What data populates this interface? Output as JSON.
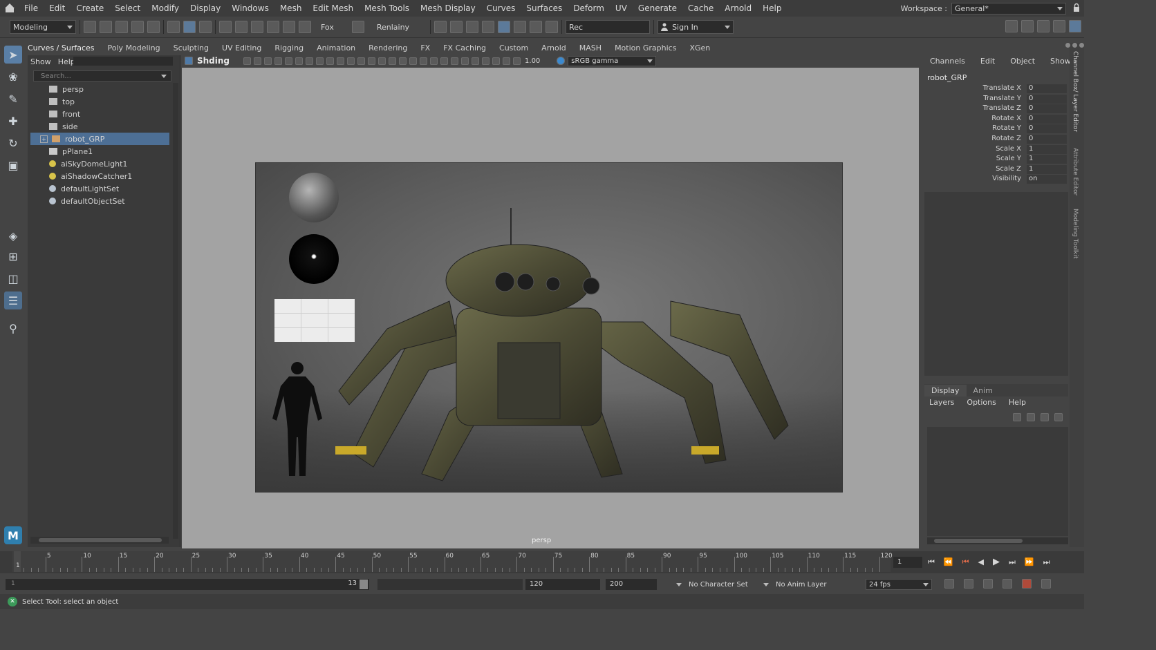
{
  "menubar": {
    "items": [
      "File",
      "Edit",
      "Create",
      "Select",
      "Modify",
      "Display",
      "Windows",
      "Mesh",
      "Edit Mesh",
      "Mesh Tools",
      "Mesh Display",
      "Curves",
      "Surfaces",
      "Deform",
      "UV",
      "Generate",
      "Cache",
      "Arnold",
      "Help"
    ],
    "workspace_label": "Workspace :",
    "workspace_value": "General*"
  },
  "statusline": {
    "mode": "Modeling",
    "field_a": "Fox",
    "field_b": "Renlainy",
    "rec_label": "Rec",
    "sign_in": "Sign In"
  },
  "shelf_tabs": [
    "Curves / Surfaces",
    "Poly Modeling",
    "Sculpting",
    "UV Editing",
    "Rigging",
    "Animation",
    "Rendering",
    "FX",
    "FX Caching",
    "Custom",
    "Arnold",
    "MASH",
    "Motion Graphics",
    "XGen"
  ],
  "outliner": {
    "menu": [
      "Show",
      "Help"
    ],
    "search_placeholder": "Search...",
    "items": [
      {
        "label": "persp",
        "icon": "camera-icon"
      },
      {
        "label": "top",
        "icon": "camera-icon"
      },
      {
        "label": "front",
        "icon": "camera-icon"
      },
      {
        "label": "side",
        "icon": "camera-icon"
      },
      {
        "label": "robot_GRP",
        "icon": "group-icon"
      },
      {
        "label": "pPlane1",
        "icon": "mesh-icon"
      },
      {
        "label": "aiSkyDomeLight1",
        "icon": "light-icon"
      },
      {
        "label": "aiShadowCatcher1",
        "icon": "light-icon"
      },
      {
        "label": "defaultLightSet",
        "icon": "set-icon"
      },
      {
        "label": "defaultObjectSet",
        "icon": "set-icon"
      }
    ],
    "selected": "robot_GRP"
  },
  "viewport": {
    "panel_label": "Shding",
    "exposure": "1.00",
    "colorspace": "sRGB gamma",
    "camera_label": "persp"
  },
  "channelbox": {
    "menu": [
      "Channels",
      "Edit",
      "Object",
      "Show"
    ],
    "object": "robot_GRP",
    "attributes": [
      {
        "name": "Translate X",
        "value": "0"
      },
      {
        "name": "Translate Y",
        "value": "0"
      },
      {
        "name": "Translate Z",
        "value": "0"
      },
      {
        "name": "Rotate X",
        "value": "0"
      },
      {
        "name": "Rotate Y",
        "value": "0"
      },
      {
        "name": "Rotate Z",
        "value": "0"
      },
      {
        "name": "Scale X",
        "value": "1"
      },
      {
        "name": "Scale Y",
        "value": "1"
      },
      {
        "name": "Scale Z",
        "value": "1"
      },
      {
        "name": "Visibility",
        "value": "on"
      }
    ],
    "side_tabs": [
      "Channel Box/ Layer Editor",
      "Attribute Editor",
      "Modeling Toolkit"
    ]
  },
  "layers": {
    "tabs": [
      "Display",
      "Anim"
    ],
    "menu": [
      "Layers",
      "Options",
      "Help"
    ]
  },
  "timeline": {
    "ticks": [
      "5",
      "10",
      "15",
      "20",
      "25",
      "30",
      "35",
      "40",
      "45",
      "50",
      "55",
      "60",
      "65",
      "70",
      "75",
      "80",
      "85",
      "90",
      "95",
      "100",
      "105",
      "110",
      "115",
      "120"
    ],
    "first_frame": "1",
    "current_frame": "1"
  },
  "rangebar": {
    "start": "1",
    "slider_end": "120",
    "end": "120",
    "max": "200",
    "character_set": "No Character Set",
    "anim_layer": "No Anim Layer",
    "fps": "24 fps",
    "slider_value": "13"
  },
  "helpline": {
    "text": "Select Tool: select an object"
  }
}
